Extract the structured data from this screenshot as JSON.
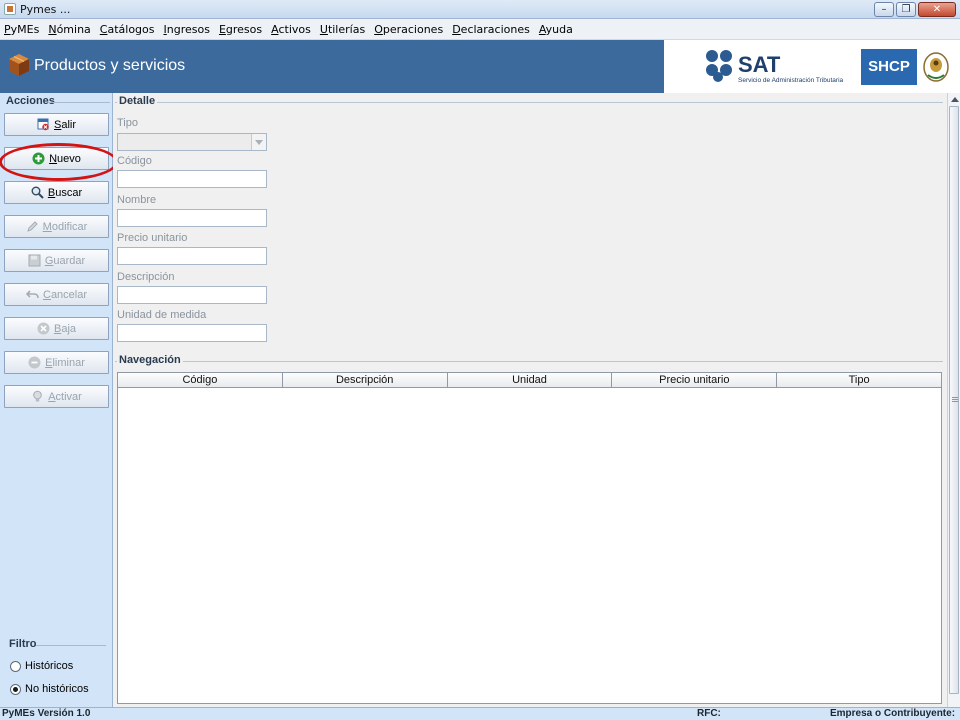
{
  "window": {
    "title": "Pymes ..."
  },
  "menu": [
    "PyMEs",
    "Nómina",
    "Catálogos",
    "Ingresos",
    "Egresos",
    "Activos",
    "Utilerías",
    "Operaciones",
    "Declaraciones",
    "Ayuda"
  ],
  "banner": {
    "title": "Productos y servicios",
    "sat_logo": "SAT",
    "sat_subtitle": "Servicio de Administración Tributaria",
    "shcp_logo": "SHCP",
    "background_color": "#3d6a9c"
  },
  "actions": {
    "label": "Acciones",
    "buttons": [
      {
        "label": "Salir",
        "icon": "exit-icon",
        "enabled": true
      },
      {
        "label": "Nuevo",
        "icon": "add-icon",
        "enabled": true
      },
      {
        "label": "Buscar",
        "icon": "search-icon",
        "enabled": true
      },
      {
        "label": "Modificar",
        "icon": "pencil-icon",
        "enabled": false
      },
      {
        "label": "Guardar",
        "icon": "save-icon",
        "enabled": false
      },
      {
        "label": "Cancelar",
        "icon": "undo-icon",
        "enabled": false
      },
      {
        "label": "Baja",
        "icon": "remove-icon",
        "enabled": false
      },
      {
        "label": "Eliminar",
        "icon": "delete-icon",
        "enabled": false
      },
      {
        "label": "Activar",
        "icon": "lightbulb-icon",
        "enabled": false
      }
    ]
  },
  "filter": {
    "label": "Filtro",
    "options": [
      {
        "label": "Históricos",
        "selected": false
      },
      {
        "label": "No históricos",
        "selected": true
      }
    ]
  },
  "detail": {
    "legend": "Detalle",
    "tipo_label": "Tipo",
    "tipo_value": "",
    "fields": [
      {
        "label": "Código",
        "value": ""
      },
      {
        "label": "Nombre",
        "value": ""
      },
      {
        "label": "Precio unitario",
        "value": ""
      },
      {
        "label": "Descripción",
        "value": ""
      },
      {
        "label": "Unidad de medida",
        "value": ""
      }
    ]
  },
  "navigation": {
    "legend": "Navegación",
    "columns": [
      "Código",
      "Descripción",
      "Unidad",
      "Precio unitario",
      "Tipo"
    ],
    "rows": []
  },
  "status": {
    "version": "PyMEs Versión 1.0",
    "rfc_label": "RFC:",
    "empresa_label": "Empresa o Contribuyente:"
  }
}
